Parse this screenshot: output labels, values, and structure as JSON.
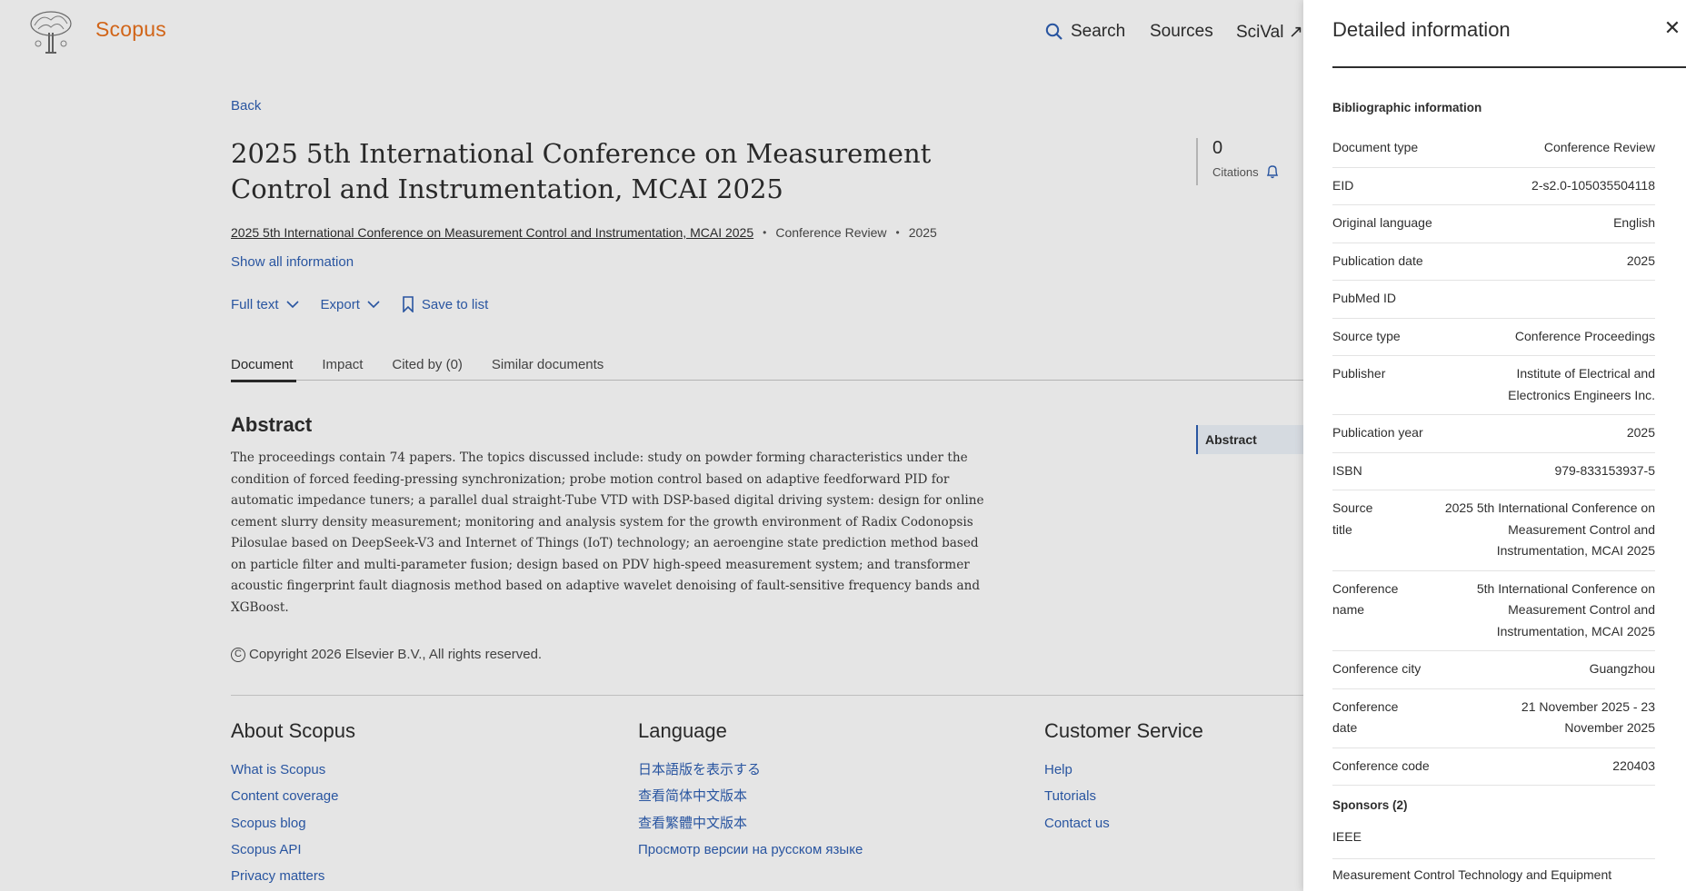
{
  "brand": {
    "name": "Scopus"
  },
  "nav": {
    "search": "Search",
    "sources": "Sources",
    "scival": "SciVal ↗"
  },
  "back": "Back",
  "document": {
    "title": "2025 5th International Conference on Measurement Control and Instrumentation, MCAI 2025",
    "source": "2025 5th International Conference on Measurement Control and Instrumentation, MCAI 2025",
    "doc_type": "Conference Review",
    "year": "2025",
    "show_all": "Show all information"
  },
  "actions": {
    "full_text": "Full text",
    "export": "Export",
    "save_to_list": "Save to list"
  },
  "citations": {
    "count": "0",
    "label": "Citations"
  },
  "tabs": [
    "Document",
    "Impact",
    "Cited by (0)",
    "Similar documents"
  ],
  "abstract": {
    "heading": "Abstract",
    "text": "The proceedings contain 74 papers. The topics discussed include: study on powder forming characteristics under the condition of forced feeding-pressing synchronization; probe motion control based on adaptive feedforward PID for automatic impedance tuners; a parallel dual straight-Tube VTD with DSP-based digital driving system: design for online cement slurry density measurement; monitoring and analysis system for the growth environment of Radix Codonopsis Pilosulae based on DeepSeek-V3 and Internet of Things (IoT) technology; an aeroengine state prediction method based on particle filter and multi-parameter fusion; design based on PDV high-speed measurement system; and transformer acoustic fingerprint fault diagnosis method based on adaptive wavelet denoising of fault-sensitive frequency bands and XGBoost.",
    "toc_label": "Abstract"
  },
  "copyright": "Copyright 2026 Elsevier B.V., All rights reserved.",
  "footer": {
    "about": {
      "heading": "About Scopus",
      "links": [
        "What is Scopus",
        "Content coverage",
        "Scopus blog",
        "Scopus API",
        "Privacy matters"
      ]
    },
    "language": {
      "heading": "Language",
      "links": [
        "日本語版を表示する",
        "查看简体中文版本",
        "查看繁體中文版本",
        "Просмотр версии на русском языке"
      ]
    },
    "service": {
      "heading": "Customer Service",
      "links": [
        "Help",
        "Tutorials",
        "Contact us"
      ]
    }
  },
  "panel": {
    "title": "Detailed information",
    "close_icon": "close-icon",
    "section_biblio": "Bibliographic information",
    "rows": [
      {
        "key": "Document type",
        "value": "Conference Review"
      },
      {
        "key": "EID",
        "value": "2-s2.0-105035504118"
      },
      {
        "key": "Original language",
        "value": "English"
      },
      {
        "key": "Publication date",
        "value": "2025"
      },
      {
        "key": "PubMed ID",
        "value": ""
      },
      {
        "key": "Source type",
        "value": "Conference Proceedings"
      },
      {
        "key": "Publisher",
        "value": "Institute of Electrical and Electronics Engineers Inc."
      },
      {
        "key": "Publication year",
        "value": "2025"
      },
      {
        "key": "ISBN",
        "value": "979-833153937-5"
      },
      {
        "key": "Source title",
        "value": "2025 5th International Conference on Measurement Control and Instrumentation, MCAI 2025"
      },
      {
        "key": "Conference name",
        "value": "5th International Conference on Measurement Control and Instrumentation, MCAI 2025"
      },
      {
        "key": "Conference city",
        "value": "Guangzhou"
      },
      {
        "key": "Conference date",
        "value": "21 November 2025 - 23 November 2025"
      },
      {
        "key": "Conference code",
        "value": "220403"
      }
    ],
    "section_sponsors": "Sponsors (2)",
    "sponsors": [
      "IEEE",
      "Measurement Control Technology and Equipment"
    ]
  },
  "colors": {
    "brand": "#e9711c",
    "link": "#2e5fb3",
    "text": "#2e2e2e"
  }
}
